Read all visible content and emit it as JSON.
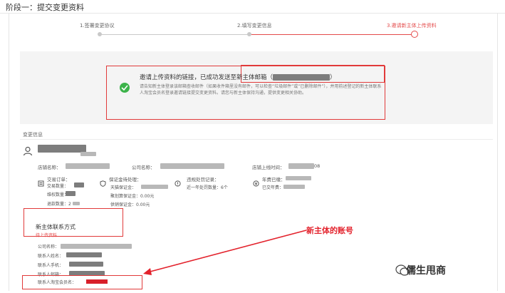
{
  "page": {
    "title": "阶段一：提交变更资料"
  },
  "steps": [
    {
      "label": "1.签署变更协议",
      "active": false
    },
    {
      "label": "2.填写变更信息",
      "active": false
    },
    {
      "label": "3.邀请新主体上传资料",
      "active": true
    }
  ],
  "notice": {
    "headline": "邀请上传资料的链接，已成功发送至新主体邮箱（",
    "headline_end": "）",
    "body": "请告知新主体登录该邮箱查收邮件（如果收件箱里没有邮件，可以检查“垃圾邮件”或“已删除邮件”），并用前述登记的新主体联系人淘宝会员名登录邀请链接提交变更资料。请您与新主体保持沟通，提供变更相关协助。"
  },
  "change_info": {
    "section_title": "变更信息",
    "user_sub": "",
    "shop_name_label": "店铺名称：",
    "company_label": "公司名称：",
    "shop_online_label": "店铺上线时间：",
    "shop_online_value": "08",
    "orders": {
      "title": "交易订单：",
      "rows": [
        "交易数量：",
        "维权数量：",
        "退款数量：2"
      ]
    },
    "deposit": {
      "title": "保证金待处理：",
      "rows": [
        "天猫保证金：",
        "聚划算保证金：0.00元",
        "供销保证金：0.00元"
      ]
    },
    "violation": {
      "title": "违规处罚记录：",
      "rows": [
        "近一年处罚数量：6个"
      ]
    },
    "annual_fee": {
      "title": "年费已缴：",
      "rows": [
        "已交年费："
      ]
    }
  },
  "contact": {
    "title": "新主体联系方式",
    "subtitle": "待上传资料",
    "rows": [
      "公司名称：",
      "联系人姓名：",
      "联系人手机：",
      "联系人邮箱：",
      "联系人淘宝会员名："
    ]
  },
  "annotation": {
    "text": "新主体的账号"
  },
  "watermark": {
    "text": "儒生甩商"
  },
  "colors": {
    "accent_red": "#e44a4a",
    "box_red": "#e13a3a",
    "success_green": "#3cb34a",
    "arrow_red": "#e3222c"
  }
}
